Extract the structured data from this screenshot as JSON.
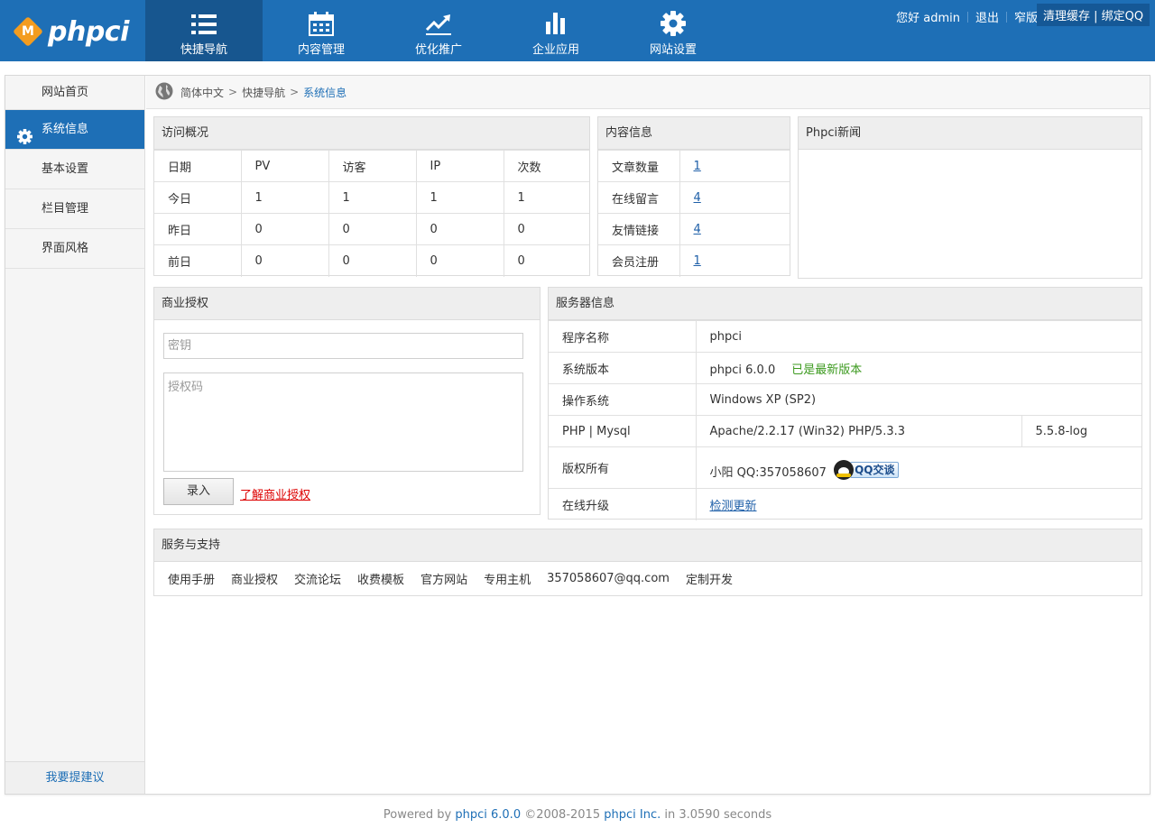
{
  "brand": {
    "logo_letter": "M",
    "name": "phpci"
  },
  "nav": [
    {
      "label": "快捷导航",
      "icon": "list-icon",
      "active": true
    },
    {
      "label": "内容管理",
      "icon": "calendar-icon",
      "active": false
    },
    {
      "label": "优化推广",
      "icon": "trend-icon",
      "active": false
    },
    {
      "label": "企业应用",
      "icon": "bar-chart-icon",
      "active": false
    },
    {
      "label": "网站设置",
      "icon": "gear-icon",
      "active": false
    }
  ],
  "top_right": {
    "greeting": "您好 admin",
    "logout": "退出",
    "narrow": "窄版",
    "cache": "清理缓存 | 绑定QQ"
  },
  "sidebar": {
    "items": [
      {
        "label": "网站首页"
      },
      {
        "label": "系统信息"
      },
      {
        "label": "基本设置"
      },
      {
        "label": "栏目管理"
      },
      {
        "label": "界面风格"
      }
    ],
    "bottom": "我要提建议"
  },
  "breadcrumb": {
    "lang": "简体中文",
    "sep": ">",
    "section": "快捷导航",
    "current": "系统信息"
  },
  "visits": {
    "title": "访问概况",
    "headers": [
      "日期",
      "PV",
      "访客",
      "IP",
      "次数"
    ],
    "rows": [
      [
        "今日",
        "1",
        "1",
        "1",
        "1"
      ],
      [
        "昨日",
        "0",
        "0",
        "0",
        "0"
      ],
      [
        "前日",
        "0",
        "0",
        "0",
        "0"
      ]
    ]
  },
  "content_info": {
    "title": "内容信息",
    "rows": [
      [
        "文章数量",
        "1"
      ],
      [
        "在线留言",
        "4"
      ],
      [
        "友情链接",
        "4"
      ],
      [
        "会员注册",
        "1"
      ]
    ]
  },
  "news": {
    "title": "Phpci新闻"
  },
  "license": {
    "title": "商业授权",
    "key_placeholder": "密钥",
    "code_placeholder": "授权码",
    "submit": "录入",
    "learn_more": "了解商业授权"
  },
  "server": {
    "title": "服务器信息",
    "program_label": "程序名称",
    "program": "phpci",
    "version_label": "系统版本",
    "version": "phpci 6.0.0",
    "version_status": "已是最新版本",
    "os_label": "操作系统",
    "os": "Windows XP (SP2)",
    "php_label": "PHP | Mysql",
    "php": "Apache/2.2.17 (Win32) PHP/5.3.3",
    "mysql": "5.5.8-log",
    "copyright_label": "版权所有",
    "copyright": "小阳 QQ:357058607",
    "qq_badge": "QQ交谈",
    "upgrade_label": "在线升级",
    "upgrade": "检测更新"
  },
  "support": {
    "title": "服务与支持",
    "links": [
      "使用手册",
      "商业授权",
      "交流论坛",
      "收费模板",
      "官方网站",
      "专用主机",
      "357058607@qq.com",
      "定制开发"
    ]
  },
  "footer": {
    "powered": "Powered by",
    "version": "phpci 6.0.0",
    "years": "©2008-2015",
    "company": "phpci Inc.",
    "timing": "in 3.0590 seconds"
  },
  "colors": {
    "primary": "#1e6fb6",
    "active_nav": "#17568f",
    "accent": "#f39c1f"
  }
}
